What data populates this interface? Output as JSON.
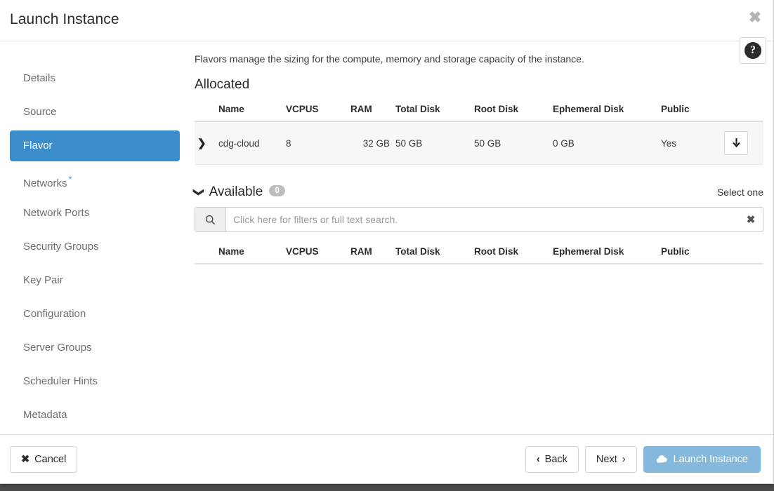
{
  "window": {
    "title": "Launch Instance",
    "close_icon": "close-x-icon",
    "help_icon": "help-circle-icon",
    "help_glyph": "?"
  },
  "sidebar": {
    "items": [
      {
        "label": "Details",
        "active": false,
        "required": false
      },
      {
        "label": "Source",
        "active": false,
        "required": false
      },
      {
        "label": "Flavor",
        "active": true,
        "required": false
      },
      {
        "label": "Networks",
        "active": false,
        "required": true
      },
      {
        "label": "Network Ports",
        "active": false,
        "required": false
      },
      {
        "label": "Security Groups",
        "active": false,
        "required": false
      },
      {
        "label": "Key Pair",
        "active": false,
        "required": false
      },
      {
        "label": "Configuration",
        "active": false,
        "required": false
      },
      {
        "label": "Server Groups",
        "active": false,
        "required": false
      },
      {
        "label": "Scheduler Hints",
        "active": false,
        "required": false
      },
      {
        "label": "Metadata",
        "active": false,
        "required": false
      }
    ],
    "required_marker": "*",
    "active_color": "#3c8dcc"
  },
  "content": {
    "description": "Flavors manage the sizing for the compute, memory and storage capacity of the instance.",
    "allocated": {
      "title": "Allocated",
      "columns": [
        "Name",
        "VCPUS",
        "RAM",
        "Total Disk",
        "Root Disk",
        "Ephemeral Disk",
        "Public"
      ],
      "rows": [
        {
          "expand_icon": "chevron-right-icon",
          "name": "cdg-cloud",
          "vcpus": "8",
          "ram": "32 GB",
          "total_disk": "50 GB",
          "root_disk": "50 GB",
          "ephemeral_disk": "0 GB",
          "public": "Yes",
          "action_icon": "arrow-down-icon",
          "action_glyph": "⬇"
        }
      ]
    },
    "available": {
      "collapse_icon": "chevron-down-icon",
      "title": "Available",
      "count": "0",
      "hint": "Select one",
      "columns": [
        "Name",
        "VCPUS",
        "RAM",
        "Total Disk",
        "Root Disk",
        "Ephemeral Disk",
        "Public"
      ],
      "rows": []
    },
    "search": {
      "icon": "search-icon",
      "placeholder": "Click here for filters or full text search.",
      "value": "",
      "clear_icon": "clear-x-icon",
      "clear_glyph": "✖"
    }
  },
  "footer": {
    "cancel_label": "Cancel",
    "cancel_glyph": "✖",
    "back_label": "Back",
    "back_glyph": "‹",
    "next_label": "Next",
    "next_glyph": "›",
    "launch_label": "Launch Instance",
    "launch_icon": "cloud-upload-icon",
    "launch_color": "#85b8dd"
  }
}
